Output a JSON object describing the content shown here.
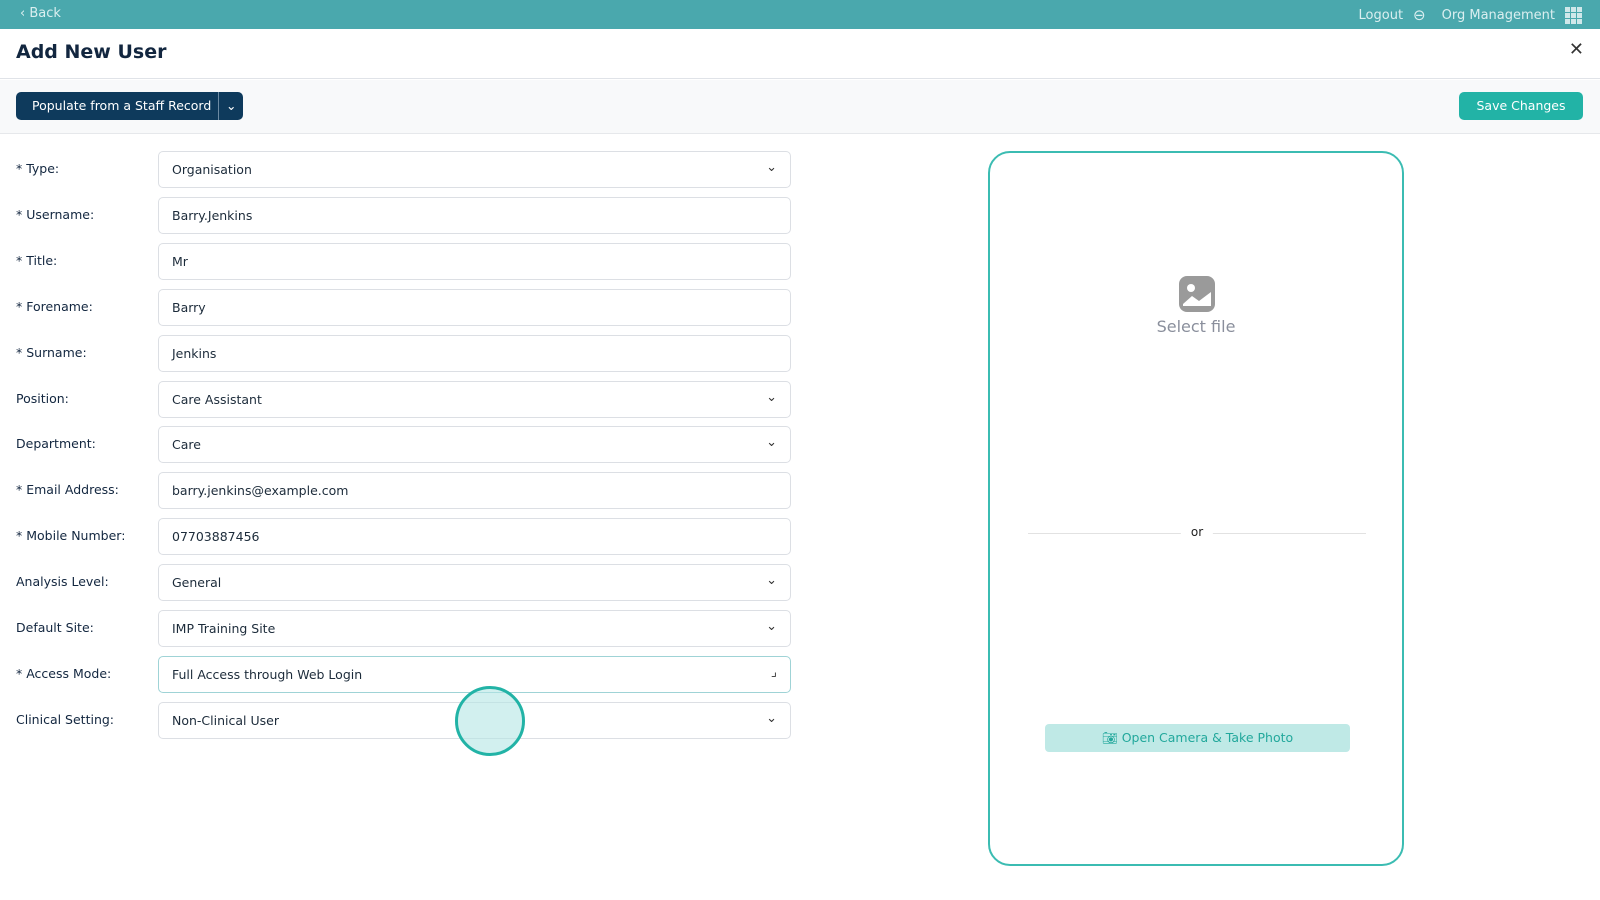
{
  "topbar": {
    "back": "‹ Back",
    "logout": "Logout",
    "org": "Org Management"
  },
  "header": {
    "title": "Add New User",
    "close": "✕"
  },
  "toolbar": {
    "populate": "Populate from a Staff Record",
    "save": "Save Changes"
  },
  "form": [
    {
      "label": "* Type:",
      "value": "Organisation",
      "dropdown": true
    },
    {
      "label": "* Username:",
      "value": "Barry.Jenkins",
      "dropdown": false
    },
    {
      "label": "* Title:",
      "value": "Mr",
      "dropdown": false
    },
    {
      "label": "* Forename:",
      "value": "Barry",
      "dropdown": false
    },
    {
      "label": "* Surname:",
      "value": "Jenkins",
      "dropdown": false
    },
    {
      "label": "Position:",
      "value": "Care Assistant",
      "dropdown": true
    },
    {
      "label": "Department:",
      "value": "Care",
      "dropdown": true
    },
    {
      "label": "* Email Address:",
      "value": "barry.jenkins@example.com",
      "dropdown": false
    },
    {
      "label": "* Mobile Number:",
      "value": "07703887456",
      "dropdown": false
    },
    {
      "label": "Analysis Level:",
      "value": "General",
      "dropdown": true
    },
    {
      "label": "Default Site:",
      "value": "IMP Training Site",
      "dropdown": true
    },
    {
      "label": "* Access Mode:",
      "value": "Full Access through Web Login",
      "dropdown": true
    },
    {
      "label": "Clinical Setting:",
      "value": "Non-Clinical User",
      "dropdown": true
    }
  ],
  "upload": {
    "select": "Select file",
    "or": "or",
    "camera": "Open Camera & Take Photo"
  },
  "colors": {
    "topbar": "#4aa8ad",
    "primary": "#0e3a5c",
    "accent": "#22b3a6"
  }
}
